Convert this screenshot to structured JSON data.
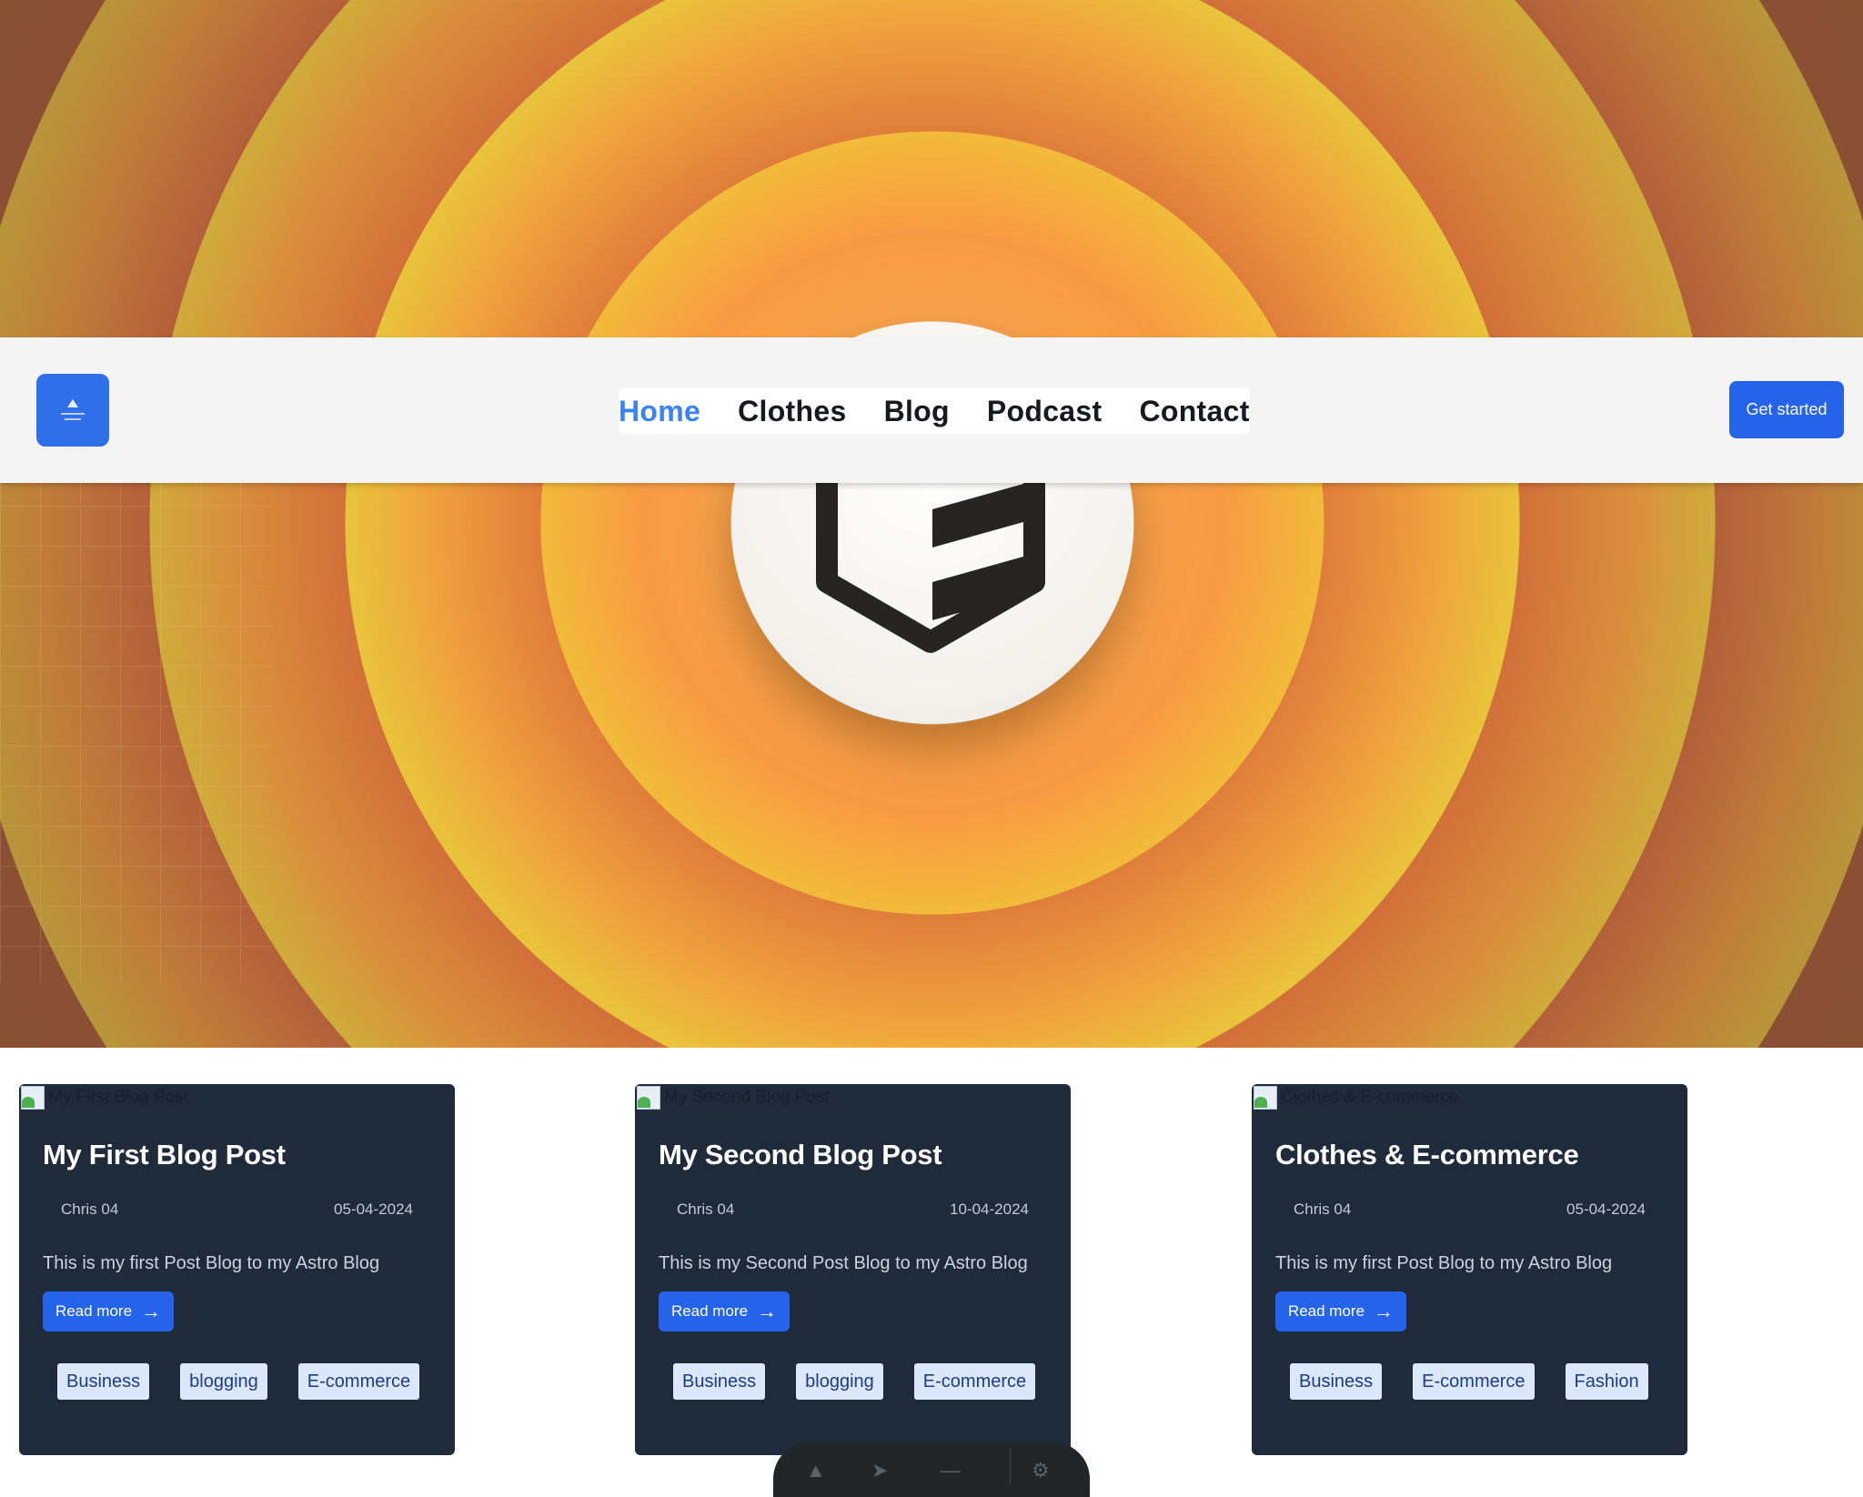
{
  "navbar": {
    "links": [
      {
        "label": "Home",
        "active": true
      },
      {
        "label": "Clothes"
      },
      {
        "label": "Blog"
      },
      {
        "label": "Podcast"
      },
      {
        "label": "Contact"
      }
    ],
    "cta_label": "Get started"
  },
  "posts": [
    {
      "image_alt": "My First Blog Post",
      "title": "My First Blog Post",
      "author": "Chris 04",
      "date": "05-04-2024",
      "description": "This is my first Post Blog to my Astro Blog",
      "read_more": "Read more",
      "tags": [
        "Business",
        "blogging",
        "E-commerce"
      ]
    },
    {
      "image_alt": "My Second Blog Post",
      "title": "My Second Blog Post",
      "author": "Chris 04",
      "date": "10-04-2024",
      "description": "This is my Second Post Blog to my Astro Blog",
      "read_more": "Read more",
      "tags": [
        "Business",
        "blogging",
        "E-commerce"
      ]
    },
    {
      "image_alt": "Clothes & E-commerce",
      "title": "Clothes & E-commerce",
      "author": "Chris 04",
      "date": "05-04-2024",
      "description": "This is my first Post Blog to my Astro Blog",
      "read_more": "Read more",
      "tags": [
        "Business",
        "E-commerce",
        "Fashion"
      ]
    }
  ],
  "colors": {
    "accent": "#2563eb",
    "active_link": "#3b82f6",
    "card_bg": "#1f2a3b",
    "tag_bg": "#dbe8fb"
  },
  "icons": {
    "hero_logo": "astro-shield-logo",
    "nav_logo": "site-logo",
    "read_more_arrow": "arrow-right-icon"
  }
}
